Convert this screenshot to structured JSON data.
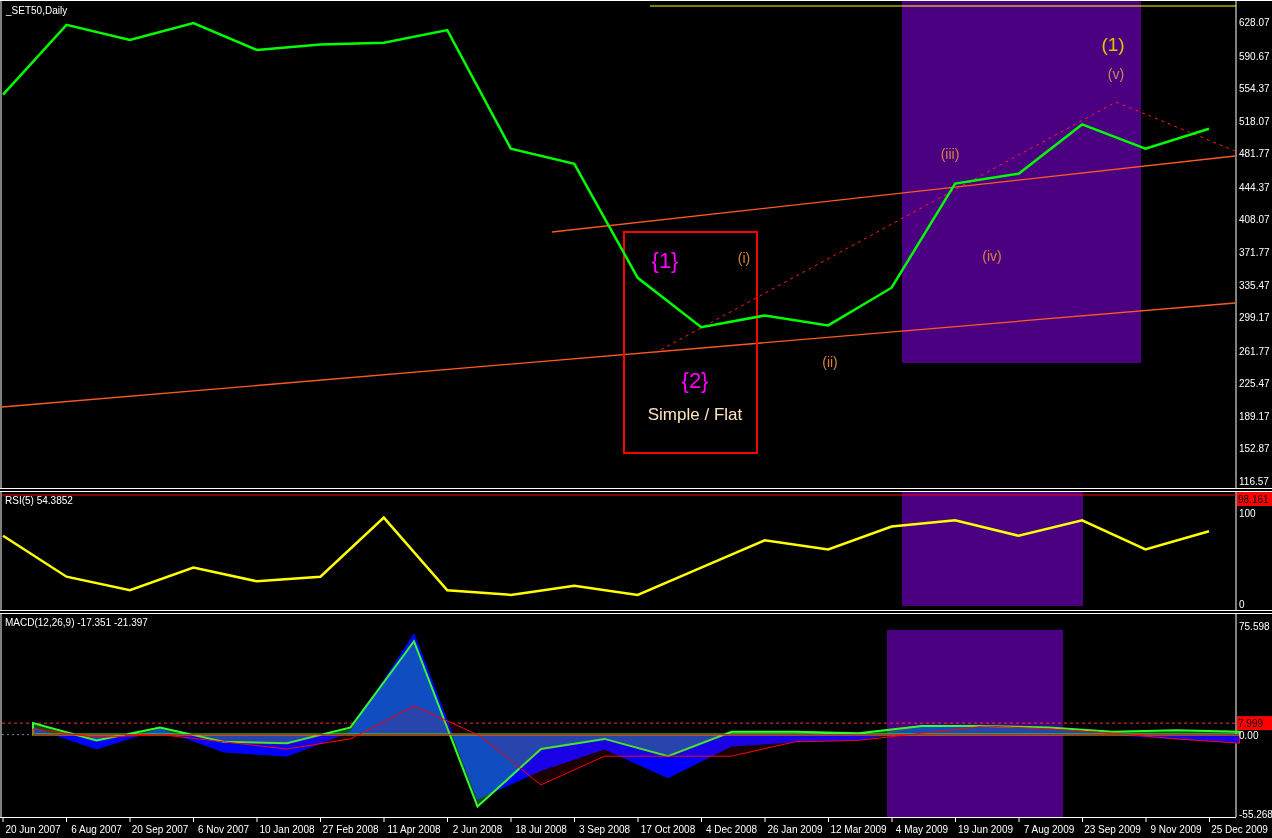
{
  "price_pane": {
    "title": "_SET50,Daily",
    "chart_data": {
      "type": "line",
      "categories": [
        null,
        null,
        null,
        null,
        null,
        null,
        null,
        null,
        null,
        null,
        null,
        null,
        null,
        null,
        null,
        null,
        null,
        null,
        null,
        null
      ],
      "series": [
        {
          "color": "#00ff00",
          "values": [
            547,
            625,
            608,
            627,
            597,
            603,
            605,
            619,
            487,
            470,
            343,
            288,
            301,
            290,
            332,
            448,
            459,
            514,
            487,
            509
          ]
        }
      ],
      "ylim": [
        116.57,
        628.07
      ],
      "yticks": [
        {
          "value": 628.07,
          "label": "628.07"
        },
        {
          "value": 590.67,
          "label": "590.67"
        },
        {
          "value": 554.37,
          "label": "554.37"
        },
        {
          "value": 518.07,
          "label": "518.07"
        },
        {
          "value": 481.77,
          "label": "481.77"
        },
        {
          "value": 444.37,
          "label": "444.37"
        },
        {
          "value": 408.07,
          "label": "408.07"
        },
        {
          "value": 371.77,
          "label": "371.77"
        },
        {
          "value": 335.47,
          "label": "335.47"
        },
        {
          "value": 299.17,
          "label": "299.17"
        },
        {
          "value": 261.77,
          "label": "261.77"
        },
        {
          "value": 225.47,
          "label": "225.47"
        },
        {
          "value": 189.17,
          "label": "189.17"
        },
        {
          "value": 152.87,
          "label": "152.87"
        },
        {
          "value": 116.57,
          "label": "116.57"
        }
      ]
    },
    "wave_labels": [
      {
        "kind": "bracket",
        "text": "{1}",
        "color": "#ff00ff"
      },
      {
        "kind": "bracket",
        "text": "{2}",
        "color": "#ff00ff"
      },
      {
        "kind": "note",
        "text": "Simple / Flat",
        "color": "#ffe4c4"
      },
      {
        "kind": "minor",
        "text": "(i)",
        "color": "#d9823b"
      },
      {
        "kind": "minor",
        "text": "(ii)",
        "color": "#d9823b"
      },
      {
        "kind": "minor",
        "text": "(iii)",
        "color": "#d9823b"
      },
      {
        "kind": "minor",
        "text": "(iv)",
        "color": "#d9823b"
      },
      {
        "kind": "major",
        "text": "(1)",
        "color": "#e8c000"
      },
      {
        "kind": "minor",
        "text": "(v)",
        "color": "#c98a5a"
      }
    ]
  },
  "rsi_pane": {
    "title": "RSI(5) 54.3852",
    "axis_tag": "98.161",
    "chart_data": {
      "type": "line",
      "ylim": [
        0,
        100
      ],
      "yticks": [
        {
          "value": 100,
          "label": "100"
        },
        {
          "value": 0,
          "label": "0"
        }
      ],
      "categories": [
        null,
        null,
        null,
        null,
        null,
        null,
        null,
        null,
        null,
        null,
        null,
        null,
        null,
        null,
        null,
        null,
        null,
        null,
        null,
        null
      ],
      "series": [
        {
          "color": "#ffff00",
          "values": [
            75,
            30,
            15,
            40,
            25,
            30,
            95,
            15,
            10,
            20,
            10,
            40,
            70,
            60,
            85,
            92,
            75,
            92,
            60,
            80
          ]
        }
      ]
    }
  },
  "macd_pane": {
    "title": "MACD(12,26,9) -17.351 -21.397",
    "axis_tag": "7.999",
    "chart_data": {
      "type": "area",
      "categories": [
        "20 Jun 2007",
        "6 Aug 2007",
        "20 Sep 2007",
        "6 Nov 2007",
        "10 Jan 2008",
        "27 Feb 2008",
        "11 Apr 2008",
        "2 Jun 2008",
        "18 Jul 2008",
        "3 Sep 2008",
        "17 Oct 2008",
        "4 Dec 2008",
        "26 Jan 2009",
        "12 Mar 2009",
        "4 May 2009",
        "19 Jun 2009",
        "7 Aug 2009",
        "23 Sep 2009",
        "9 Nov 2009",
        "25 Dec 2009"
      ],
      "series": [
        {
          "color": "#0000ff",
          "values": [
            5,
            -10,
            4,
            -12,
            -15,
            2,
            70,
            -45,
            -25,
            -10,
            -30,
            -8,
            -5,
            -4,
            5,
            5,
            4,
            0,
            -3,
            -6
          ]
        },
        {
          "color": "#32ff32",
          "values": [
            8,
            -4,
            5,
            -5,
            -6,
            5,
            65,
            -50,
            -10,
            -3,
            -15,
            2,
            2,
            1,
            6,
            6,
            5,
            2,
            3,
            2
          ]
        },
        {
          "color": "#ff0000",
          "values": [
            4,
            -2,
            0,
            -5,
            -10,
            -3,
            20,
            0,
            -35,
            -15,
            -15,
            -15,
            -5,
            -4,
            1,
            6,
            4,
            1,
            -3,
            -6
          ]
        }
      ],
      "ylim": [
        -73.21,
        75.598
      ],
      "yticks": [
        {
          "value": 75.598,
          "label": "75.598"
        },
        {
          "value": 0,
          "label": "0.00"
        },
        {
          "value": -55.268,
          "label": "-55.268"
        }
      ]
    }
  }
}
